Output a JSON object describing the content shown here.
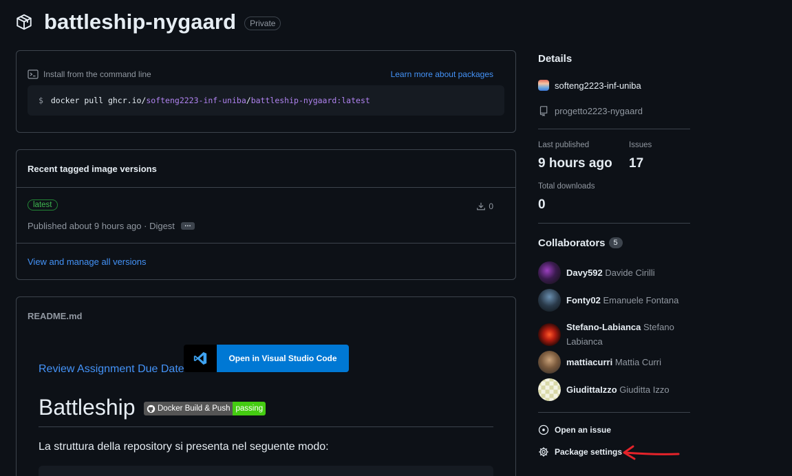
{
  "header": {
    "title": "battleship-nygaard",
    "visibility": "Private",
    "icon": "package-icon"
  },
  "install": {
    "label": "Install from the command line",
    "learn_more": "Learn more about packages",
    "prompt": "$",
    "cmd_prefix": "docker pull ghcr.io/",
    "cmd_org": "softeng2223-inf-uniba",
    "cmd_sep": "/",
    "cmd_image": "battleship-nygaard:latest"
  },
  "versions": {
    "heading": "Recent tagged image versions",
    "items": [
      {
        "tag": "latest",
        "published": "Published about 9 hours ago · Digest",
        "digest_button": "…",
        "downloads": "0"
      }
    ],
    "view_all": "View and manage all versions"
  },
  "readme": {
    "filename": "README.md",
    "review_link": "Review Assignment Due Date",
    "vscode_button": "Open in Visual Studio Code",
    "h1": "Battleship",
    "badge_left": "Docker Build & Push",
    "badge_right": "passing",
    "paragraph": "La struttura della repository si presenta nel seguente modo:"
  },
  "sidebar": {
    "details_heading": "Details",
    "org": "softeng2223-inf-uniba",
    "repo": "progetto2223-nygaard",
    "last_published_label": "Last published",
    "last_published_value": "9 hours ago",
    "issues_label": "Issues",
    "issues_value": "17",
    "downloads_label": "Total downloads",
    "downloads_value": "0",
    "collaborators_heading": "Collaborators",
    "collaborators_count": "5",
    "collaborators": [
      {
        "login": "Davy592",
        "name": "Davide Cirilli"
      },
      {
        "login": "Fonty02",
        "name": "Emanuele Fontana"
      },
      {
        "login": "Stefano-Labianca",
        "name": "Stefano Labianca"
      },
      {
        "login": "mattiacurri",
        "name": "Mattia Curri"
      },
      {
        "login": "GiudittaIzzo",
        "name": "Giuditta Izzo"
      }
    ],
    "open_issue": "Open an issue",
    "package_settings": "Package settings"
  },
  "colors": {
    "background": "#0d1117",
    "link": "#4493f8",
    "border": "#3d444d",
    "annotation_arrow": "#e5232a"
  }
}
